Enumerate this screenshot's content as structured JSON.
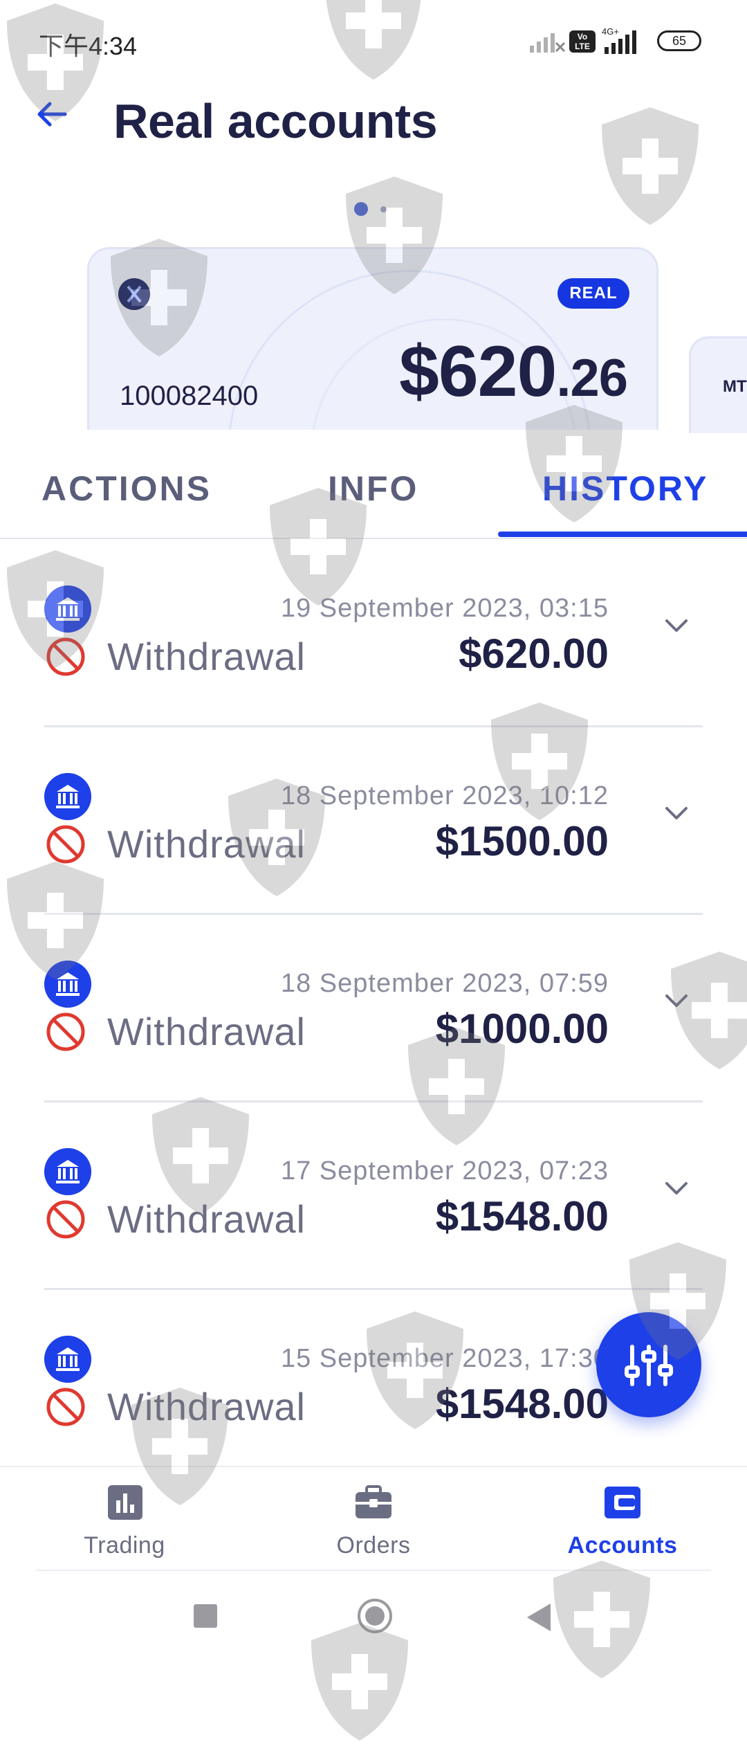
{
  "status_bar": {
    "time": "下午4:34",
    "volte": "Vo LTE",
    "network": "4G+",
    "battery": "65"
  },
  "header": {
    "title": "Real accounts"
  },
  "pager": {
    "count": 2,
    "active": 1
  },
  "account_card": {
    "badge": "REAL",
    "account_number": "100082400",
    "amount_main": "$620",
    "amount_cents": ".26"
  },
  "next_card": {
    "label": "MT"
  },
  "tabs": [
    {
      "label": "ACTIONS",
      "active": false
    },
    {
      "label": "INFO",
      "active": false
    },
    {
      "label": "HISTORY",
      "active": true
    }
  ],
  "history": [
    {
      "date": "19 September 2023, 03:15",
      "type": "Withdrawal",
      "amount": "$620.00"
    },
    {
      "date": "18 September 2023, 10:12",
      "type": "Withdrawal",
      "amount": "$1500.00"
    },
    {
      "date": "18 September 2023, 07:59",
      "type": "Withdrawal",
      "amount": "$1000.00"
    },
    {
      "date": "17 September 2023, 07:23",
      "type": "Withdrawal",
      "amount": "$1548.00"
    },
    {
      "date": "15 September 2023, 17:30",
      "type": "Withdrawal",
      "amount": "$1548.00"
    }
  ],
  "fab": {
    "icon": "filter-sliders-icon"
  },
  "bottom_nav": [
    {
      "label": "Trading",
      "icon": "bar-chart-icon",
      "active": false
    },
    {
      "label": "Orders",
      "icon": "briefcase-icon",
      "active": false
    },
    {
      "label": "Accounts",
      "icon": "wallet-icon",
      "active": true
    }
  ],
  "colors": {
    "accent": "#1e40e8",
    "text_dark": "#1f2146",
    "muted": "#6b6d83",
    "error": "#e0392f"
  }
}
